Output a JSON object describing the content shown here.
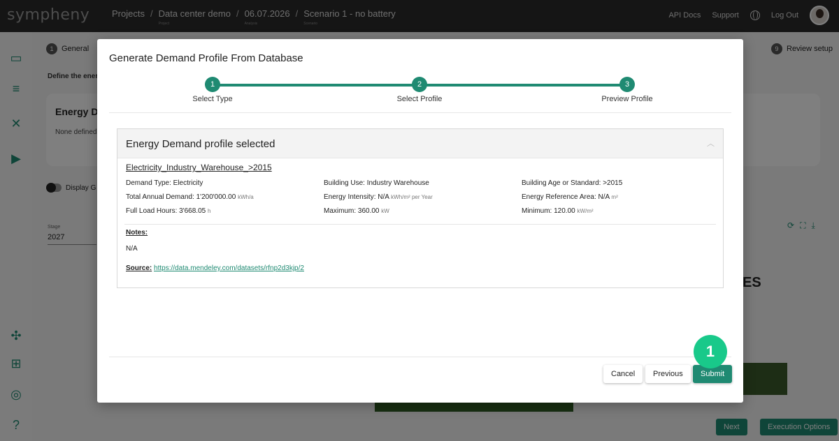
{
  "app": {
    "logo": "sympheny"
  },
  "breadcrumb": [
    {
      "label": "Projects",
      "sub": ""
    },
    {
      "label": "Data center demo",
      "sub": "Project"
    },
    {
      "label": "06.07.2026",
      "sub": "Analysis"
    },
    {
      "label": "Scenario 1 - no battery",
      "sub": "Scenario"
    }
  ],
  "header": {
    "api_docs": "API Docs",
    "support": "Support",
    "logout": "Log Out"
  },
  "background": {
    "step_first": {
      "num": "1",
      "label": "General"
    },
    "step_last": {
      "num": "9",
      "label": "Review setup"
    },
    "define_text": "Define the ener",
    "card_title": "Energy De",
    "card_text": "None defined",
    "toggle_label": "Display G",
    "stage_label": "Stage",
    "stage_value": "2027",
    "partial_text": "ES",
    "next_button": "Next",
    "execution_button": "Execution Options"
  },
  "modal": {
    "title": "Generate Demand Profile From Database",
    "steps": [
      {
        "num": "1",
        "label": "Select Type"
      },
      {
        "num": "2",
        "label": "Select Profile"
      },
      {
        "num": "3",
        "label": "Preview Profile"
      }
    ],
    "panel": {
      "title": "Energy Demand profile selected",
      "profile_name": "Electricity_Industry_Warehouse_>2015",
      "demand_type": "Demand Type: Electricity",
      "total_demand": "Total Annual Demand: 1'200'000.00",
      "total_demand_unit": "kWh/a",
      "full_load": "Full Load Hours: 3'668.05",
      "full_load_unit": "h",
      "building_use": "Building Use: Industry Warehouse",
      "energy_intensity": "Energy Intensity: N/A",
      "energy_intensity_unit": "kWh/m² per Year",
      "maximum": "Maximum: 360.00",
      "maximum_unit": "kW",
      "building_age": "Building Age or Standard: >2015",
      "reference_area": "Energy Reference Area: N/A",
      "reference_area_unit": "m²",
      "minimum": "Minimum: 120.00",
      "minimum_unit": "kW/m²",
      "notes_label": "Notes:",
      "notes_value": "N/A",
      "source_label": "Source:",
      "source_url": "https://data.mendeley.com/datasets/rfnp2d3kjp/2"
    },
    "buttons": {
      "cancel": "Cancel",
      "previous": "Previous",
      "submit": "Submit"
    }
  },
  "annotation_badge": "1",
  "colors": {
    "accent": "#1f8a72",
    "badge": "#19c98a",
    "topbar": "#2b2b2b"
  }
}
